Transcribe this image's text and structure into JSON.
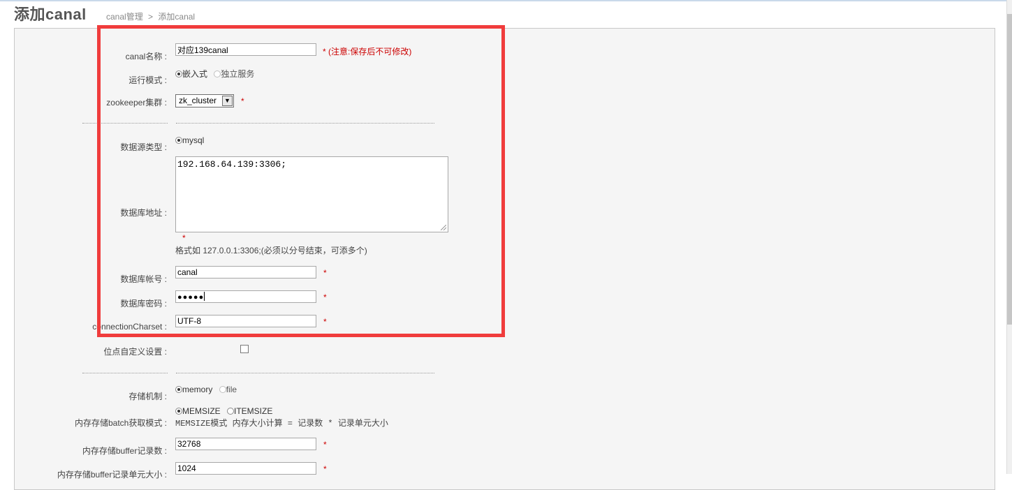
{
  "header": {
    "title": "添加canal",
    "breadcrumb": {
      "parent": "canal管理",
      "sep": ">",
      "current": "添加canal"
    }
  },
  "form": {
    "canal_name": {
      "label": "canal名称",
      "value": "对应139canal",
      "note": "* (注意:保存后不可修改)"
    },
    "run_mode": {
      "label": "运行模式",
      "options": [
        "嵌入式",
        "独立服务"
      ],
      "selected": "嵌入式"
    },
    "zookeeper": {
      "label": "zookeeper集群",
      "value": "zk_cluster",
      "required": "*"
    },
    "separator": "------------------------------------------------------------------------------------------------------------------------------",
    "datasource_type": {
      "label": "数据源类型",
      "option": "mysql"
    },
    "db_address": {
      "label": "数据库地址",
      "value": "192.168.64.139:3306;",
      "required": "*",
      "hint": "格式如 127.0.0.1:3306;(必须以分号结束，可添多个)"
    },
    "db_account": {
      "label": "数据库帐号",
      "value": "canal",
      "required": "*"
    },
    "db_password": {
      "label": "数据库密码",
      "value": "●●●●●",
      "required": "*"
    },
    "charset": {
      "label": "connectionCharset",
      "value": "UTF-8",
      "required": "*"
    },
    "position_custom": {
      "label": "位点自定义设置"
    },
    "storage": {
      "label": "存储机制",
      "options": [
        "memory",
        "file"
      ],
      "selected": "memory"
    },
    "batch_mode": {
      "label": "内存存储batch获取模式",
      "options": [
        "MEMSIZE",
        "ITEMSIZE"
      ],
      "selected": "MEMSIZE",
      "hint": "MEMSIZE模式 内存大小计算 = 记录数 * 记录单元大小"
    },
    "buffer_size": {
      "label": "内存存储buffer记录数",
      "value": "32768",
      "required": "*"
    },
    "buffer_unit": {
      "label": "内存存储buffer记录单元大小",
      "value": "1024",
      "required": "*"
    }
  },
  "colors": {
    "highlight": "#f03c3c",
    "required": "#cc0000"
  }
}
